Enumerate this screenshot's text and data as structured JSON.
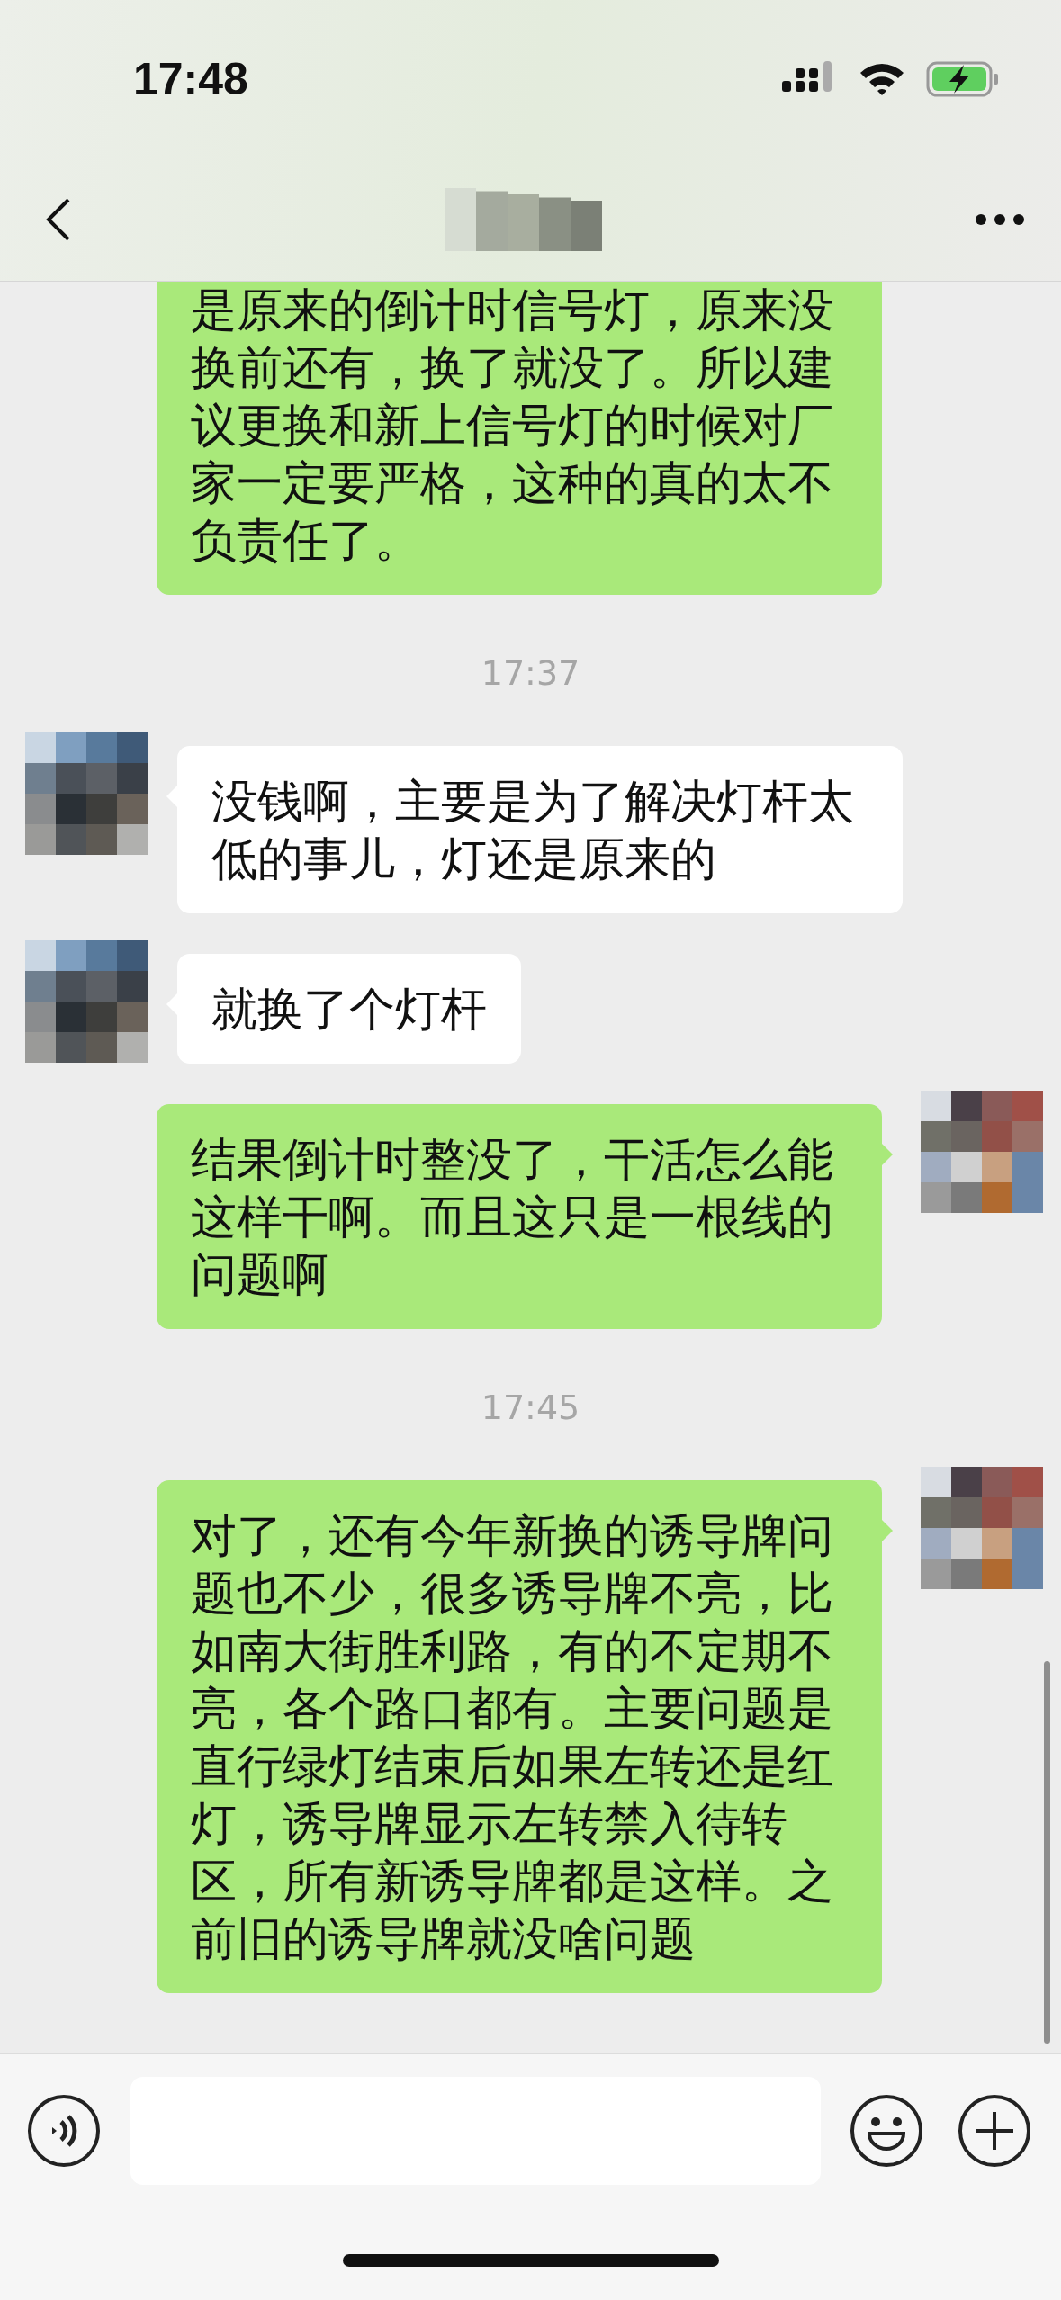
{
  "status_bar": {
    "time": "17:48"
  },
  "messages": [
    {
      "kind": "sent",
      "text": "是原来的倒计时信号灯，原来没换前还有，换了就没了。所以建议更换和新上信号灯的时候对厂家一定要严格，这种的真的太不负责任了。"
    },
    {
      "kind": "time",
      "text": "17:37"
    },
    {
      "kind": "received",
      "text": "没钱啊，主要是为了解决灯杆太低的事儿，灯还是原来的"
    },
    {
      "kind": "received",
      "text": "就换了个灯杆"
    },
    {
      "kind": "sent",
      "text": "结果倒计时整没了，干活怎么能这样干啊。而且这只是一根线的问题啊"
    },
    {
      "kind": "time",
      "text": "17:45"
    },
    {
      "kind": "sent",
      "text": "对了，还有今年新换的诱导牌问题也不少，很多诱导牌不亮，比如南大街胜利路，有的不定期不亮，各个路口都有。主要问题是直行绿灯结束后如果左转还是红灯，诱导牌显示左转禁入待转区，所有新诱导牌都是这样。之前旧的诱导牌就没啥问题"
    }
  ]
}
